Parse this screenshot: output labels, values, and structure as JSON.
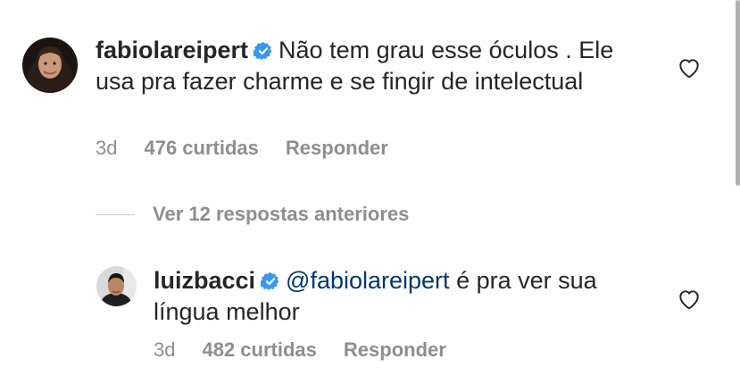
{
  "comments": [
    {
      "username": "fabiolareipert",
      "text": "Não tem grau esse óculos . Ele usa pra fazer charme e se fingir  de intelectual",
      "time": "3d",
      "likes": "476 curtidas",
      "reply": "Responder",
      "avatar_icon": "profile-photo-woman",
      "like_icon": "heart-outline"
    },
    {
      "username": "luizbacci",
      "mention": "@fabiolareipert",
      "text": " é pra ver sua língua melhor",
      "time": "3d",
      "likes": "482 curtidas",
      "reply": "Responder",
      "avatar_icon": "profile-photo-man",
      "like_icon": "heart-outline"
    }
  ],
  "view_replies": "Ver 12 respostas anteriores",
  "colors": {
    "text": "#262626",
    "secondary": "#8e8e8e",
    "mention": "#00376b",
    "verified": "#3897f0"
  }
}
